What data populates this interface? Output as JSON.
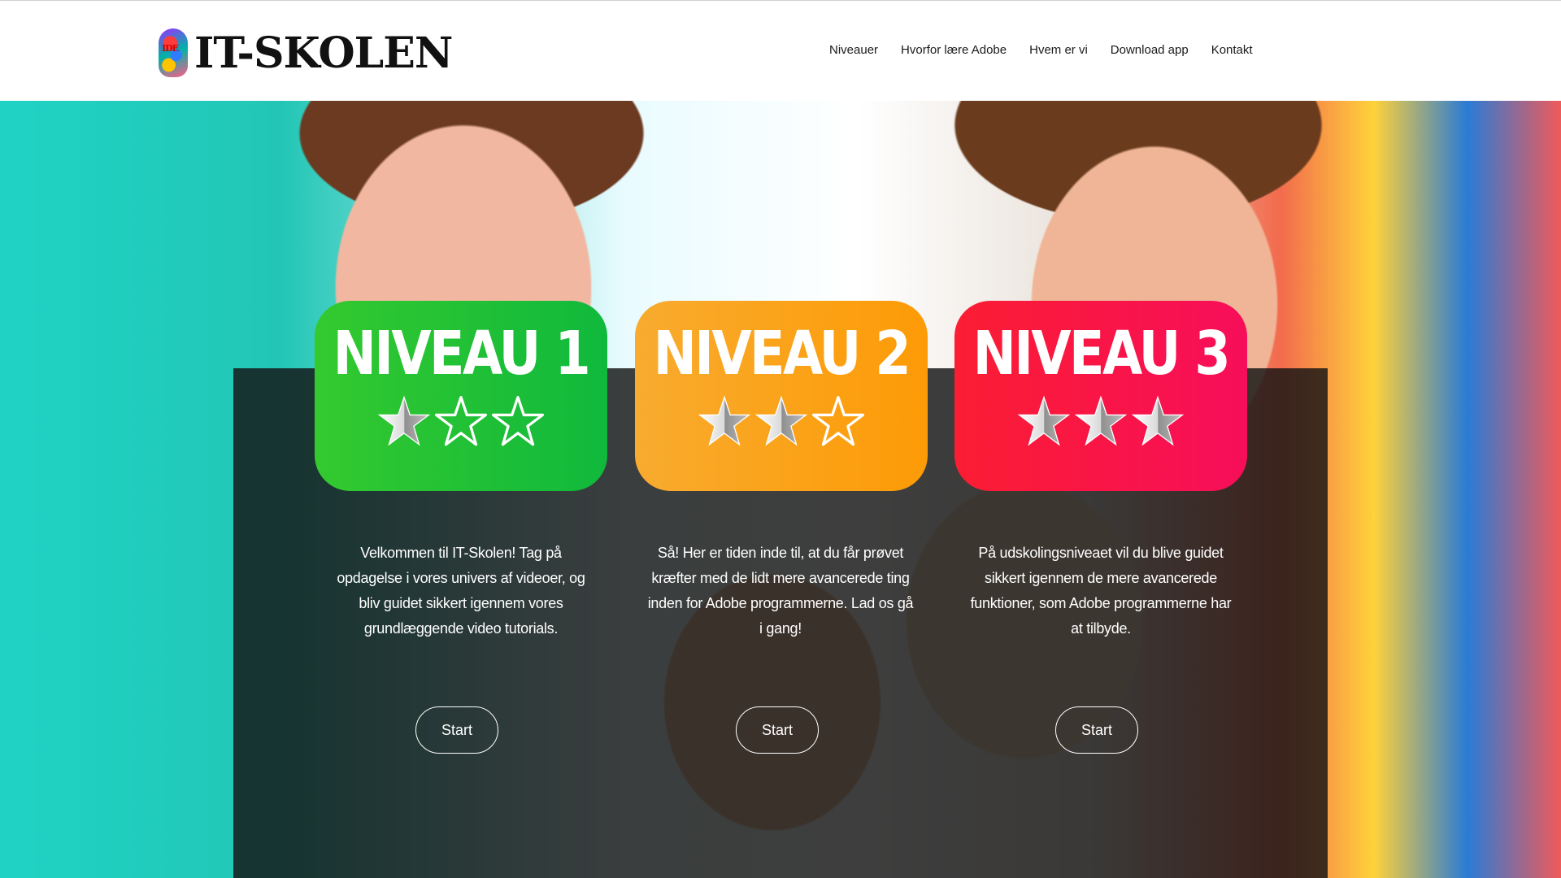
{
  "header": {
    "logo_text": "IT-SKOLEN",
    "logo_mark_text": "IDE",
    "nav": [
      "Niveauer",
      "Hvorfor lære Adobe",
      "Hvem er vi",
      "Download app",
      "Kontakt"
    ]
  },
  "levels": [
    {
      "title": "NIVEAU 1",
      "stars_filled": 1,
      "stars_total": 3,
      "color": "#1fbf36",
      "description": "Velkommen til IT-Skolen! Tag på opdagelse i vores univers af videoer, og bliv guidet sikkert igennem vores grundlæggende video tutorials.",
      "button": "Start"
    },
    {
      "title": "NIVEAU 2",
      "stars_filled": 2,
      "stars_total": 3,
      "color": "#fca31b",
      "description": "Så! Her er tiden inde til, at du får prøvet kræfter med de lidt mere avancerede ting inden for Adobe programmerne. Lad os gå i gang!",
      "button": "Start"
    },
    {
      "title": "NIVEAU 3",
      "stars_filled": 3,
      "stars_total": 3,
      "color": "#f91646",
      "description": "På udskolingsniveaet vil du blive guidet sikkert igennem de mere avancerede funktioner, som Adobe programmerne har at tilbyde.",
      "button": "Start"
    }
  ]
}
